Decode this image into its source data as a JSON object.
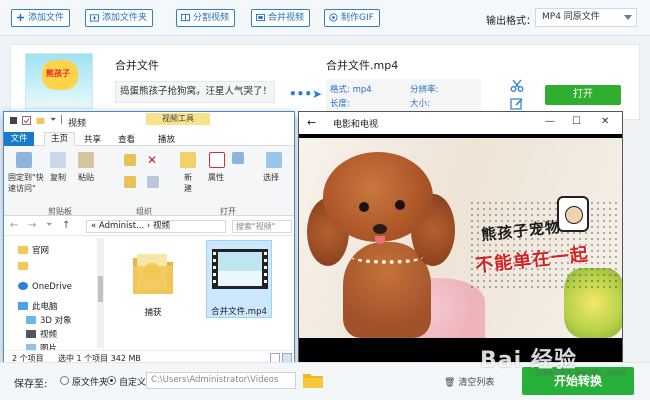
{
  "toolbar": {
    "add_file": "添加文件",
    "add_folder": "添加文件夹",
    "split_video": "分割视频",
    "merge_video": "合并视频",
    "make_gif": "制作GIF",
    "output_format_label": "输出格式：",
    "output_format_value": "MP4  同原文件"
  },
  "file_row": {
    "source_name": "合并文件",
    "caption": "捣蛋熊孩子抢狗窝，汪星人气哭了！ -",
    "dest_name": "合并文件.mp4",
    "format_label": "格式: mp4",
    "resolution_label": "分辨率:",
    "duration_label": "长度:",
    "size_label": "大小:",
    "open_button": "打开",
    "thumbnail_text": "熊孩子"
  },
  "explorer": {
    "window_title": "视频",
    "tool_tag": "视频工具",
    "tabs": {
      "file": "文件",
      "home": "主页",
      "share": "共享",
      "view": "查看",
      "play": "播放"
    },
    "ribbon": {
      "pin": "固定到\"快\n速访问\"",
      "copy": "复制",
      "paste": "粘贴",
      "new": "新\n建",
      "properties": "属性",
      "select": "选择",
      "group_clipboard": "剪贴板",
      "group_organize": "组织",
      "group_open": "打开"
    },
    "address": {
      "crumb": "« Administ... › 视频",
      "search_placeholder": "搜索\"视频\""
    },
    "nav": {
      "item_0": "官网",
      "item_1": "",
      "item_2": "OneDrive",
      "item_3": "此电脑",
      "item_4": "3D 对象",
      "item_5": "视频",
      "item_6": "图片"
    },
    "files": [
      {
        "name": "捕获"
      },
      {
        "name": "合并文件.mp4"
      }
    ],
    "status": {
      "count": "2 个项目",
      "selected": "选中 1 个项目  342 MB"
    }
  },
  "player": {
    "title": "电影和电视",
    "overlay_line1": "熊孩子宠物",
    "overlay_line2": "不能单在一起"
  },
  "bottom": {
    "save_to": "保存至:",
    "option_original": "原文件夹",
    "option_custom": "自定义",
    "path": "C:\\Users\\Administrator\\Videos",
    "clear_list": "清空列表",
    "start": "开始转换"
  },
  "watermark": {
    "text": "Bai  经验",
    "sub": "jingyan.baidu.com"
  },
  "colors": {
    "accent_blue": "#2a7fd4",
    "start_green": "#27b13a",
    "open_green": "#2fae2f",
    "overlay_red": "#d22222"
  }
}
